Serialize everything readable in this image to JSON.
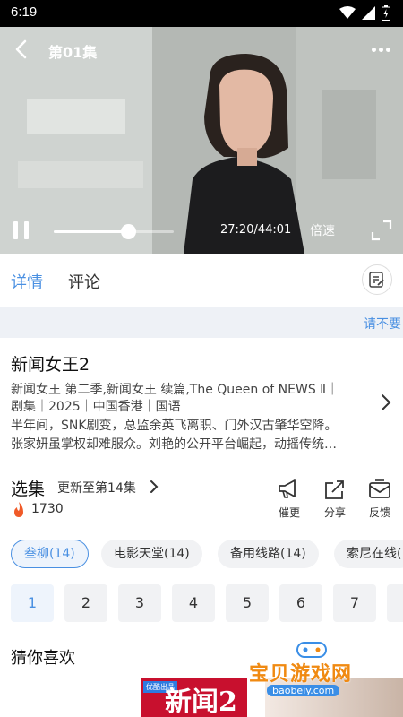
{
  "status_bar": {
    "time": "6:19"
  },
  "player": {
    "episode_title": "第01集",
    "current_time": "27:20/44:01",
    "progress": 0.62,
    "speed_label": "倍速"
  },
  "tabs": {
    "details": "详情",
    "comments": "评论"
  },
  "notice": {
    "text": "请不要"
  },
  "info": {
    "title": "新闻女王2",
    "line1": "新闻女王 第二季,新闻女王 续篇,The Queen of NEWS Ⅱ｜",
    "line2": "剧集｜2025｜中国香港｜国语",
    "line3": "半年间，SNK剧变，总监余英飞离职、门外汉古肇华空降。",
    "line4": "张家妍虽掌权却难服众。刘艳的公开平台崛起，动摇传统…"
  },
  "episodes": {
    "section_title": "选集",
    "update_text": "更新至第14集",
    "hot_count": "1730",
    "actions": {
      "remind": "催更",
      "share": "分享",
      "feedback": "反馈"
    }
  },
  "sources": [
    {
      "label": "叁柳(14)",
      "active": true
    },
    {
      "label": "电影天堂(14)",
      "active": false
    },
    {
      "label": "备用线路(14)",
      "active": false
    },
    {
      "label": "索尼在线(",
      "active": false
    }
  ],
  "episode_numbers": [
    "1",
    "2",
    "3",
    "4",
    "5",
    "6",
    "7"
  ],
  "recommend": {
    "title": "猜你喜欢",
    "card1_badge": "优酷出品",
    "card1_text": "新闻2"
  },
  "watermark": {
    "text": "宝贝游戏网",
    "url": "baobeiy.com"
  },
  "colors": {
    "accent": "#4a90e2",
    "hot": "#f05a28"
  }
}
